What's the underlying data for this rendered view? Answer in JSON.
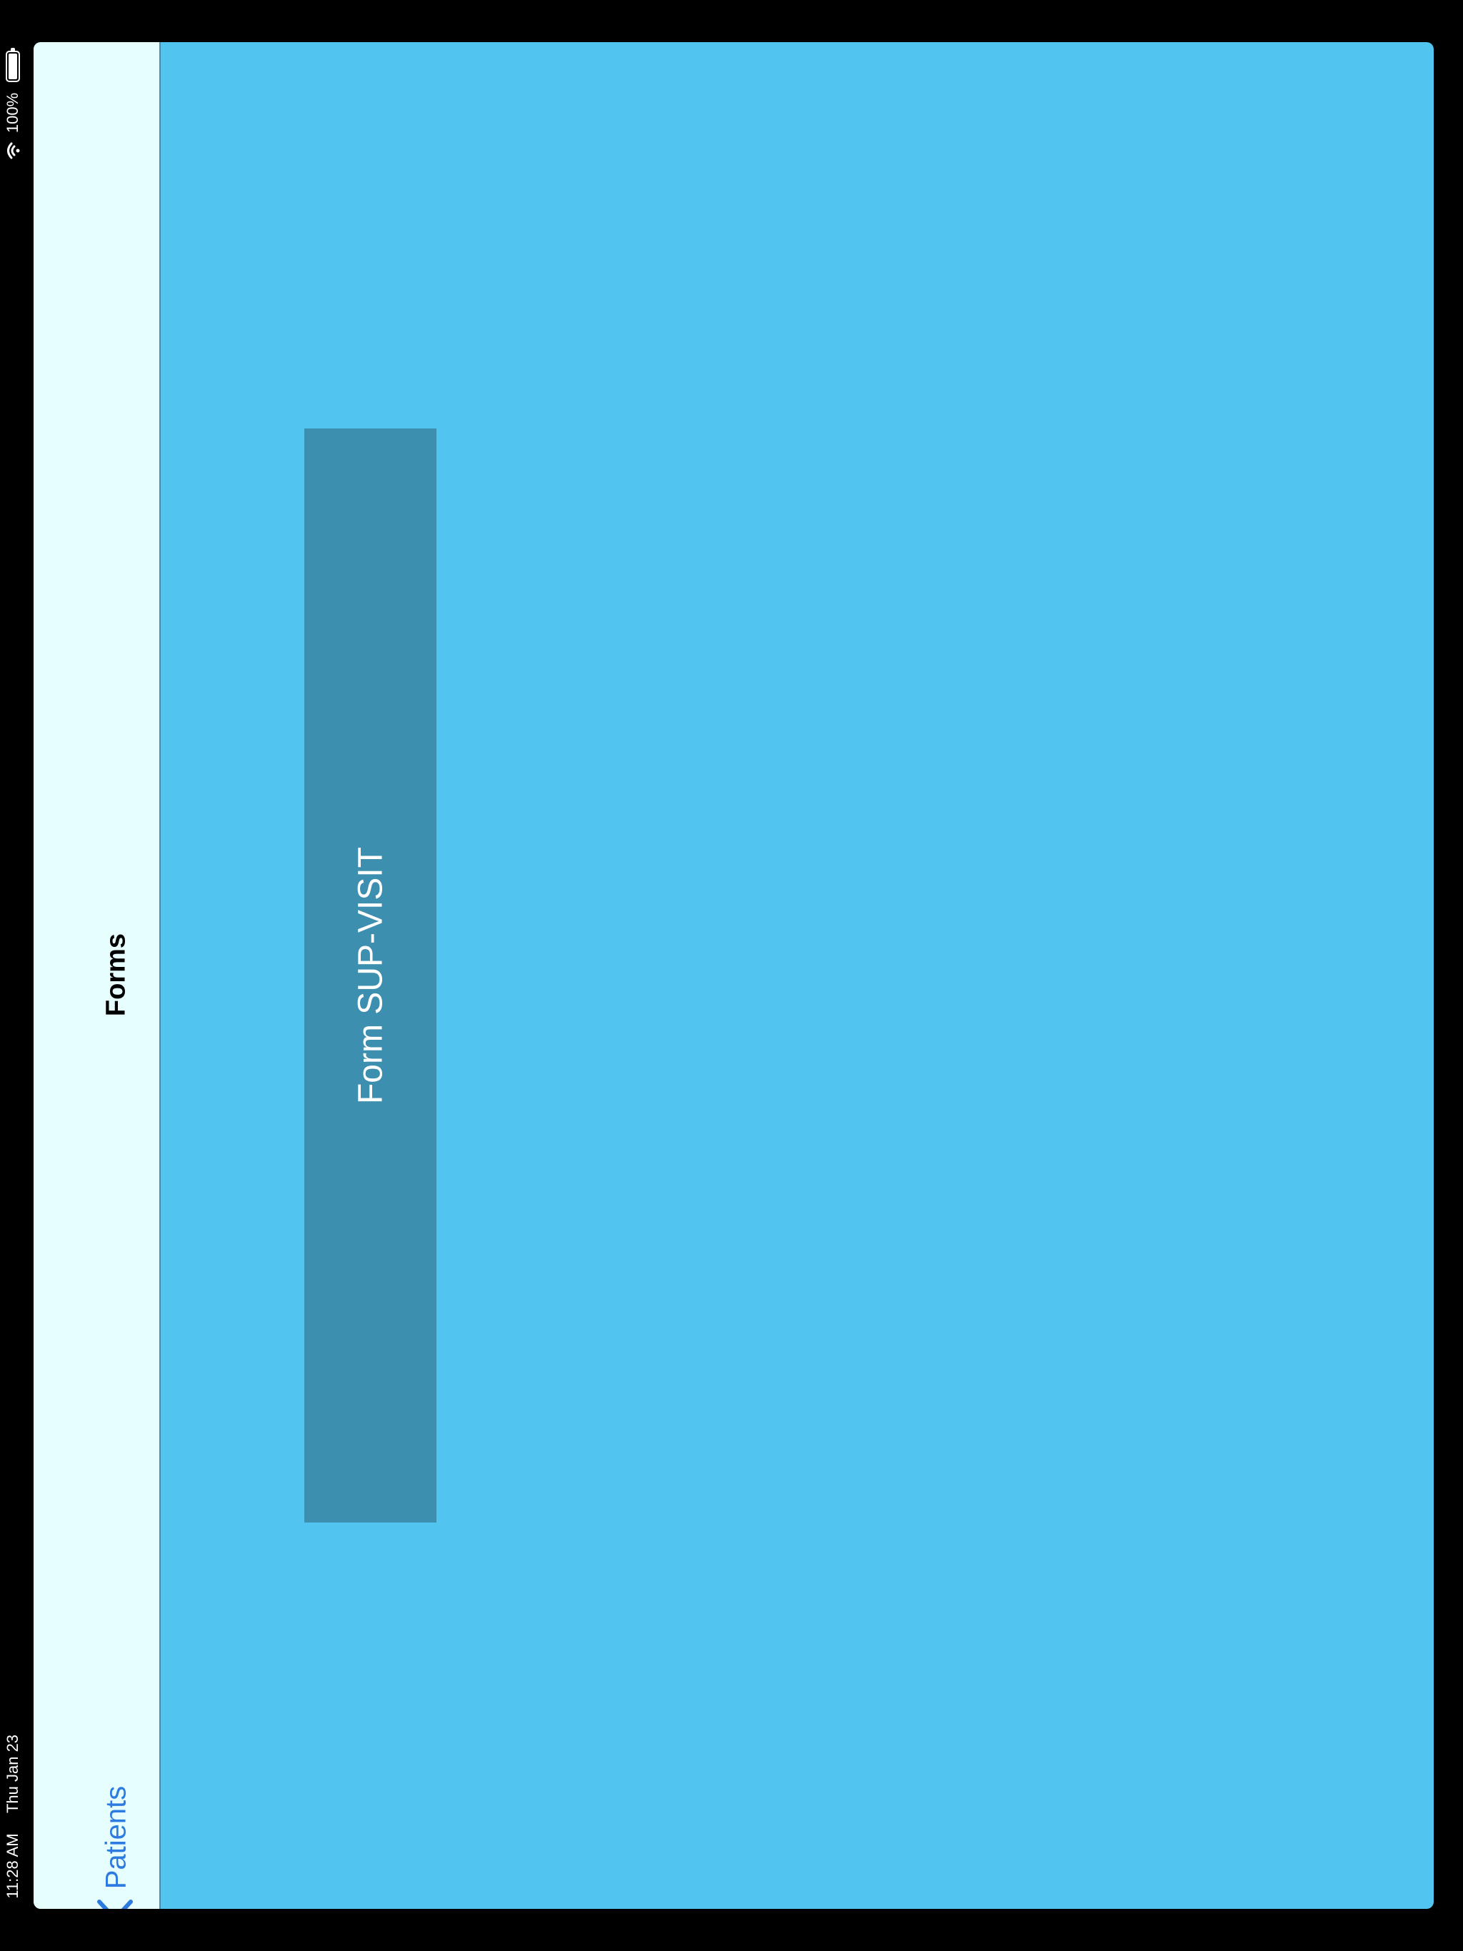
{
  "status_bar": {
    "time": "11:28 AM",
    "date": "Thu Jan 23",
    "battery_percent": "100%",
    "battery_level": 1.0,
    "icons": [
      "wifi-icon",
      "battery-icon"
    ]
  },
  "nav": {
    "title": "Forms",
    "back_label": "Patients",
    "back_icon": "chevron-left-icon"
  },
  "main": {
    "forms": [
      {
        "label": "Form SUP-VISIT"
      }
    ]
  },
  "colors": {
    "content_background": "#52c4f0",
    "nav_background": "#e6fffe",
    "form_button": "#3d8fb0",
    "link": "#2d7be0"
  }
}
